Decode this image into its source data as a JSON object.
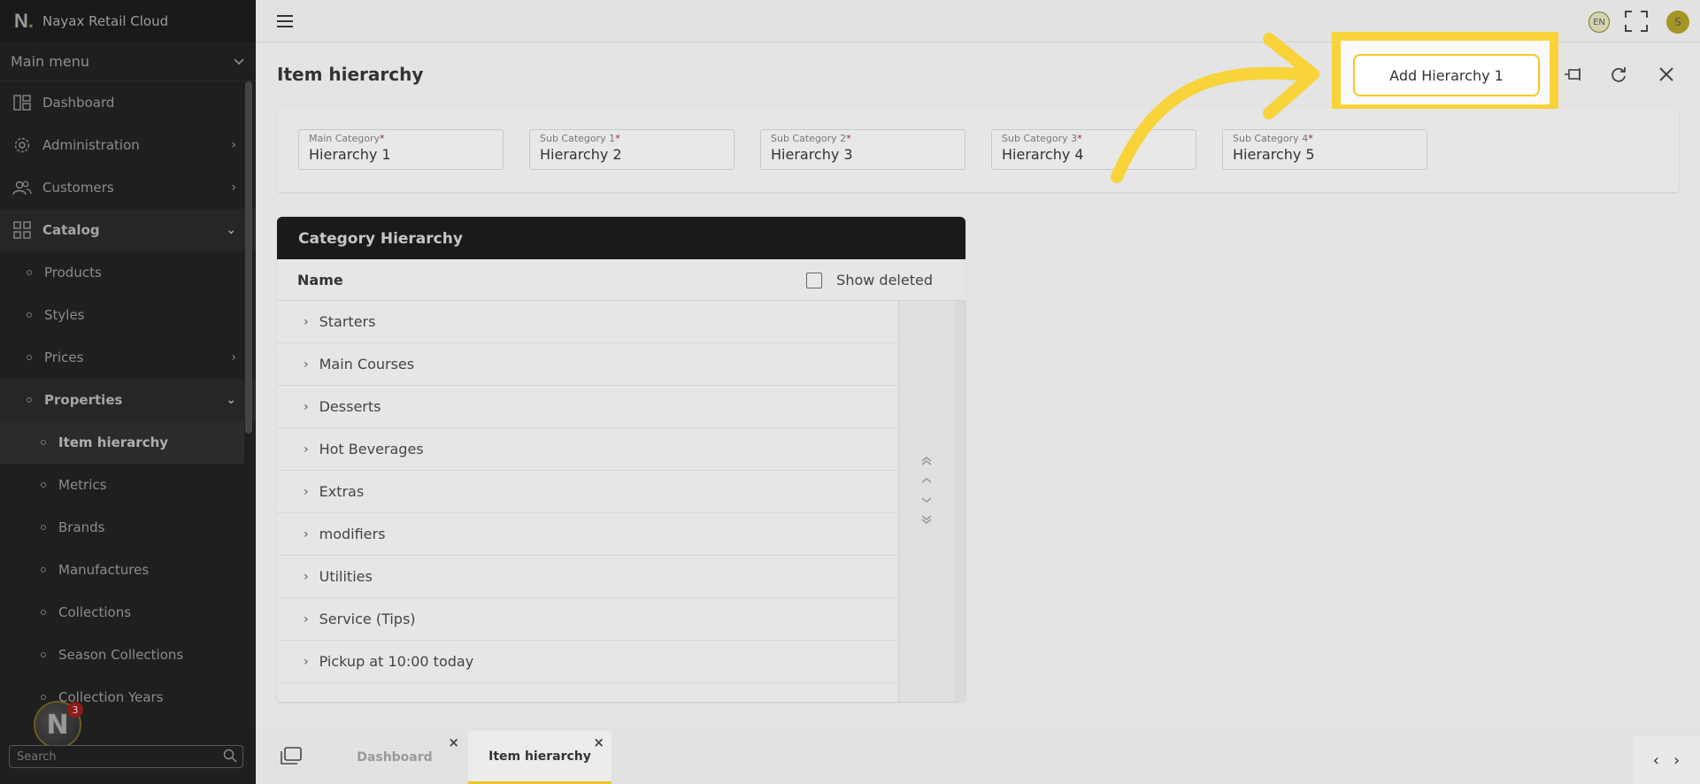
{
  "app": {
    "logo": "N",
    "name": "Nayax Retail Cloud"
  },
  "sidebar": {
    "main_menu_label": "Main menu",
    "items": [
      {
        "label": "Dashboard"
      },
      {
        "label": "Administration"
      },
      {
        "label": "Customers"
      },
      {
        "label": "Catalog"
      },
      {
        "label": "Products"
      },
      {
        "label": "Styles"
      },
      {
        "label": "Prices"
      },
      {
        "label": "Properties"
      },
      {
        "label": "Item hierarchy"
      },
      {
        "label": "Metrics"
      },
      {
        "label": "Brands"
      },
      {
        "label": "Manufactures"
      },
      {
        "label": "Collections"
      },
      {
        "label": "Season Collections"
      },
      {
        "label": "Collection Years"
      }
    ],
    "notification_count": "3",
    "search_placeholder": "Search"
  },
  "topbar": {
    "language": "EN",
    "avatar_initial": "S"
  },
  "page": {
    "title": "Item hierarchy",
    "add_button_label": "Add Hierarchy 1"
  },
  "filters": [
    {
      "label": "Main Category",
      "required_mark": "*",
      "value": "Hierarchy 1"
    },
    {
      "label": "Sub Category 1",
      "required_mark": "*",
      "value": "Hierarchy 2"
    },
    {
      "label": "Sub Category 2",
      "required_mark": "*",
      "value": "Hierarchy 3"
    },
    {
      "label": "Sub Category 3",
      "required_mark": "*",
      "value": "Hierarchy 4"
    },
    {
      "label": "Sub Category 4",
      "required_mark": "*",
      "value": "Hierarchy 5"
    }
  ],
  "panel": {
    "title": "Category Hierarchy",
    "column_name": "Name",
    "show_deleted_label": "Show deleted",
    "rows": [
      "Starters",
      "Main Courses",
      "Desserts",
      "Hot Beverages",
      "Extras",
      "modifiers",
      "Utilities",
      "Service (Tips)",
      "Pickup at 10:00 today"
    ]
  },
  "tabs": [
    {
      "label": "Dashboard"
    },
    {
      "label": "Item hierarchy"
    }
  ],
  "colors": {
    "accent": "#f8d33a",
    "sidebar_bg": "#1f1f1f",
    "panel_head_bg": "#1a1a1a"
  }
}
